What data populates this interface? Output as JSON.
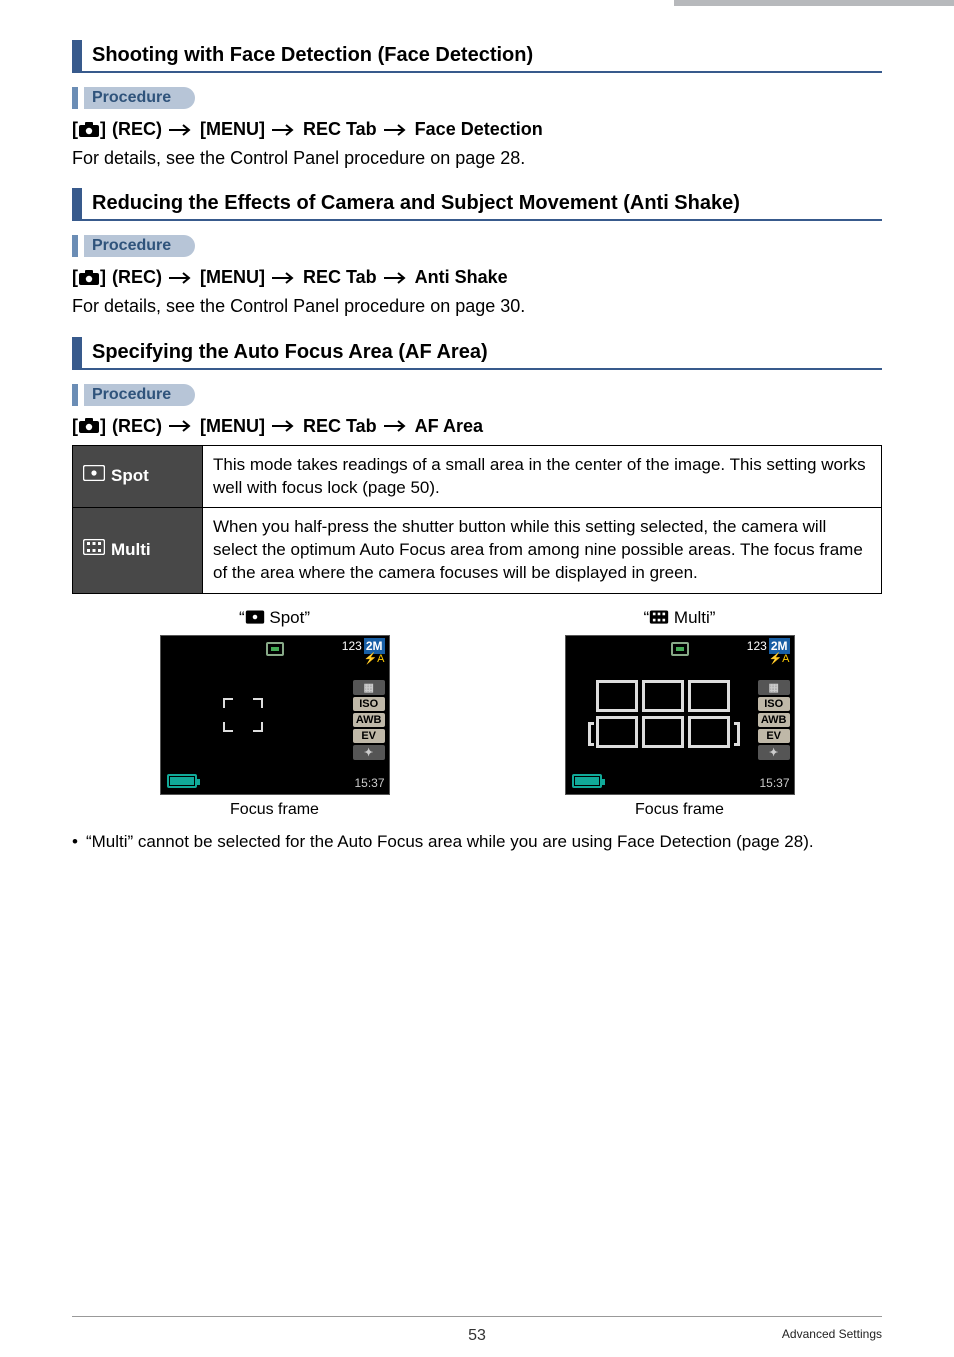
{
  "section1": {
    "title": "Shooting with Face Detection (Face Detection)",
    "procedure_label": "Procedure",
    "path": {
      "p1": "(REC)",
      "p2": "[MENU]",
      "p3": "REC Tab",
      "p4": "Face Detection"
    },
    "body": "For details, see the Control Panel procedure on page 28."
  },
  "section2": {
    "title": "Reducing the Effects of Camera and Subject Movement (Anti Shake)",
    "procedure_label": "Procedure",
    "path": {
      "p1": "(REC)",
      "p2": "[MENU]",
      "p3": "REC Tab",
      "p4": "Anti Shake"
    },
    "body": "For details, see the Control Panel procedure on page 30."
  },
  "section3": {
    "title": "Specifying the Auto Focus Area (AF Area)",
    "procedure_label": "Procedure",
    "path": {
      "p1": "(REC)",
      "p2": "[MENU]",
      "p3": "REC Tab",
      "p4": "AF Area"
    },
    "table": {
      "row1": {
        "label": "Spot",
        "desc": "This mode takes readings of a small area in the center of the image. This setting works well with focus lock (page 50)."
      },
      "row2": {
        "label": "Multi",
        "desc": "When you half-press the shutter button while this setting selected, the camera will select the optimum Auto Focus area from among nine possible areas. The focus frame of the area where the camera focuses will be displayed in green."
      }
    },
    "previews": {
      "spot_title_prefix": "“",
      "spot_title_label": " Spot”",
      "multi_title_prefix": "“",
      "multi_title_label": " Multi”",
      "caption": "Focus frame",
      "hud": {
        "count": "123",
        "badge": "2M",
        "iso": "ISO",
        "awb": "AWB",
        "ev": "EV",
        "time": "15:37"
      }
    },
    "note": "“Multi” cannot be selected for the Auto Focus area while you are using Face Detection (page 28)."
  },
  "footer": {
    "page": "53",
    "chapter": "Advanced Settings"
  }
}
